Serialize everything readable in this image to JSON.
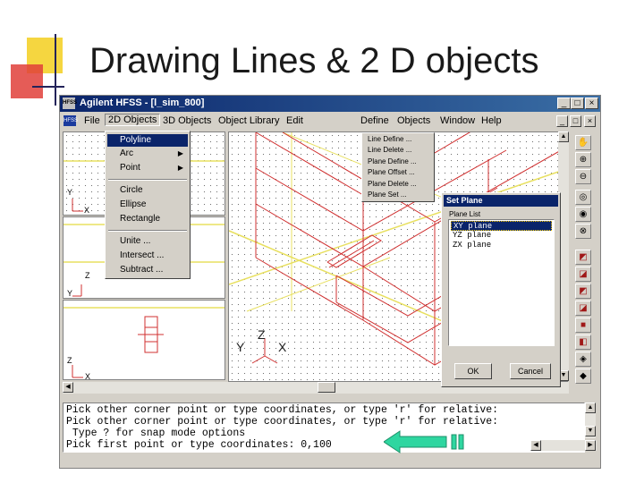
{
  "slide": {
    "title": "Drawing Lines & 2 D objects"
  },
  "window": {
    "icon_label": "HFSS",
    "title": "Agilent HFSS - [l_sim_800]",
    "controls": {
      "minimize": "_",
      "maximize": "□",
      "close": "×"
    },
    "mdi_icon_label": "HFSS"
  },
  "menubar": {
    "items": [
      "File",
      "2D Objects",
      "3D Objects",
      "Object Library",
      "Edit",
      "Define",
      "Objects",
      "Window",
      "Help"
    ]
  },
  "dropdown_2d": {
    "items": [
      {
        "label": "Polyline",
        "submenu": false,
        "selected": true
      },
      {
        "label": "Arc",
        "submenu": true
      },
      {
        "label": "Point",
        "submenu": true
      },
      {
        "label": "Circle"
      },
      {
        "label": "Ellipse"
      },
      {
        "label": "Rectangle"
      },
      {
        "label": "Unite ..."
      },
      {
        "label": "Intersect ..."
      },
      {
        "label": "Subtract ..."
      }
    ],
    "submenu_arrow": "▶"
  },
  "define_menu": {
    "items": [
      "Line Define ...",
      "Line Delete ...",
      "Plane Define ...",
      "Plane Offset ...",
      "Plane Delete ...",
      "Plane Set ..."
    ]
  },
  "set_plane_dialog": {
    "title": "Set Plane",
    "list_label": "Plane List",
    "planes": [
      "XY plane",
      "YZ plane",
      "ZX plane"
    ],
    "selected_plane": "XY plane",
    "ok_label": "OK",
    "cancel_label": "Cancel"
  },
  "axes": {
    "top_view": [
      "Y",
      "X"
    ],
    "side_view": [
      "Z",
      "Y"
    ],
    "front_view": [
      "Z",
      "X"
    ],
    "iso_view": [
      "Z",
      "Y",
      "X"
    ]
  },
  "toolbar_icons": [
    "hand-icon",
    "zoom-in-icon",
    "zoom-out-icon",
    "zoom-window-icon",
    "zoom-fit-icon",
    "zoom-all-icon",
    "view-cube-1-icon",
    "view-cube-2-icon",
    "view-cube-3-icon",
    "view-cube-4-icon",
    "view-cube-5-icon",
    "view-cube-6-icon",
    "shade-icon",
    "render-icon"
  ],
  "console": {
    "lines": [
      "Pick other corner point or type coordinates, or type 'r' for relative:",
      "Pick other corner point or type coordinates, or type 'r' for relative:",
      " Type ? for snap mode options",
      "Pick first point or type coordinates: 0,100"
    ]
  },
  "colors": {
    "model_lines": "#d03030",
    "grid_lines": "#e8e060",
    "arrow_fill": "#2fd6a0",
    "selection": "#0a246a"
  }
}
